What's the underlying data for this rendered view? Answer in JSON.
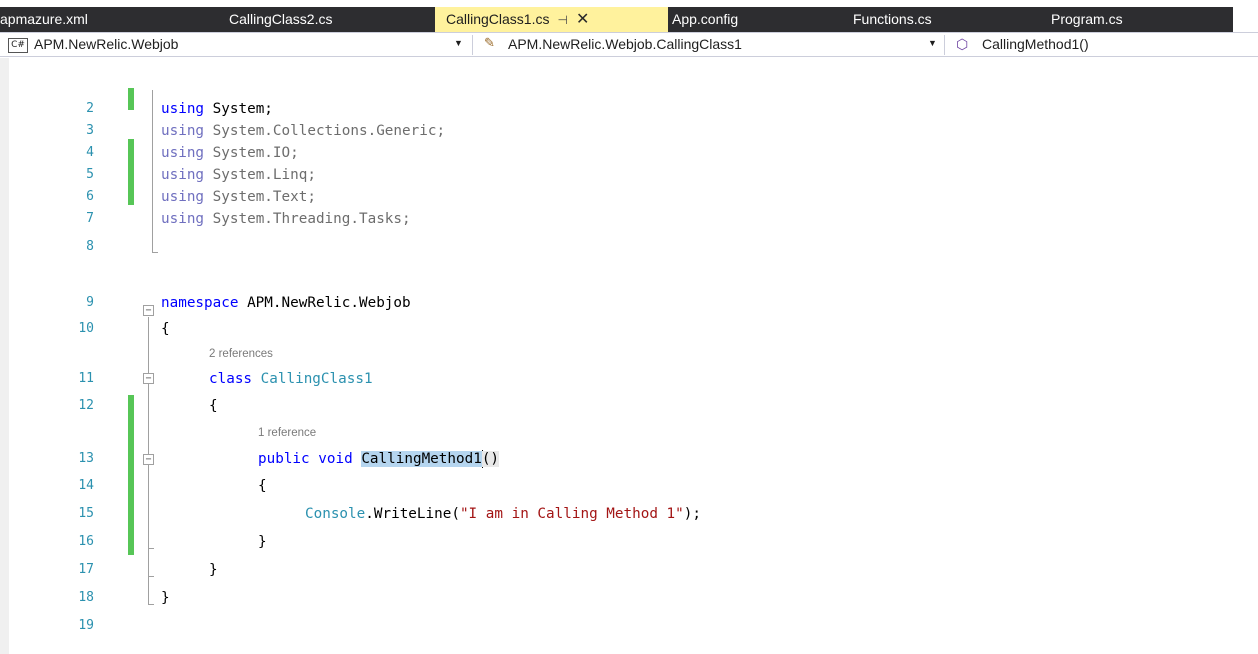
{
  "tabs": [
    {
      "label": "apmazure.xml"
    },
    {
      "label": "CallingClass2.cs"
    },
    {
      "label": "CallingClass1.cs",
      "active": true
    },
    {
      "label": "App.config"
    },
    {
      "label": "Functions.cs"
    },
    {
      "label": "Program.cs"
    }
  ],
  "tab_pin_glyph": "⊣",
  "tab_close_glyph": "✕",
  "navigation": {
    "project_icon": "C#",
    "project": "APM.NewRelic.Webjob",
    "class": "APM.NewRelic.Webjob.CallingClass1",
    "member": "CallingMethod1()"
  },
  "lens": {
    "class_refs": "2 references",
    "method_refs": "1 reference"
  },
  "code": {
    "line_numbers": [
      "2",
      "3",
      "4",
      "5",
      "6",
      "7",
      "8",
      "9",
      "10",
      "11",
      "12",
      "13",
      "14",
      "15",
      "16",
      "17",
      "18",
      "19"
    ],
    "using_keyword": "using",
    "namespaces": [
      "System;",
      "System.Collections.Generic;",
      "System.IO;",
      "System.Linq;",
      "System.Text;",
      "System.Threading.Tasks;"
    ],
    "namespace_keyword": "namespace",
    "namespace_name": "APM.NewRelic.Webjob",
    "open_brace": "{",
    "close_brace": "}",
    "class_keyword": "class",
    "class_name": "CallingClass1",
    "public_keyword": "public",
    "void_keyword": "void",
    "method_name": "CallingMethod1",
    "method_parens": "()",
    "console_type": "Console",
    "writeline_call": ".WriteLine(",
    "string_literal": "\"I am in Calling Method 1\"",
    "call_end": ");"
  },
  "colors": {
    "keyword": "#0000ff",
    "type": "#2b91af",
    "string": "#a31515",
    "line_number": "#2b91af",
    "change_marker": "#57c657",
    "active_tab": "#fff29d",
    "tab_strip": "#2d2d30"
  }
}
